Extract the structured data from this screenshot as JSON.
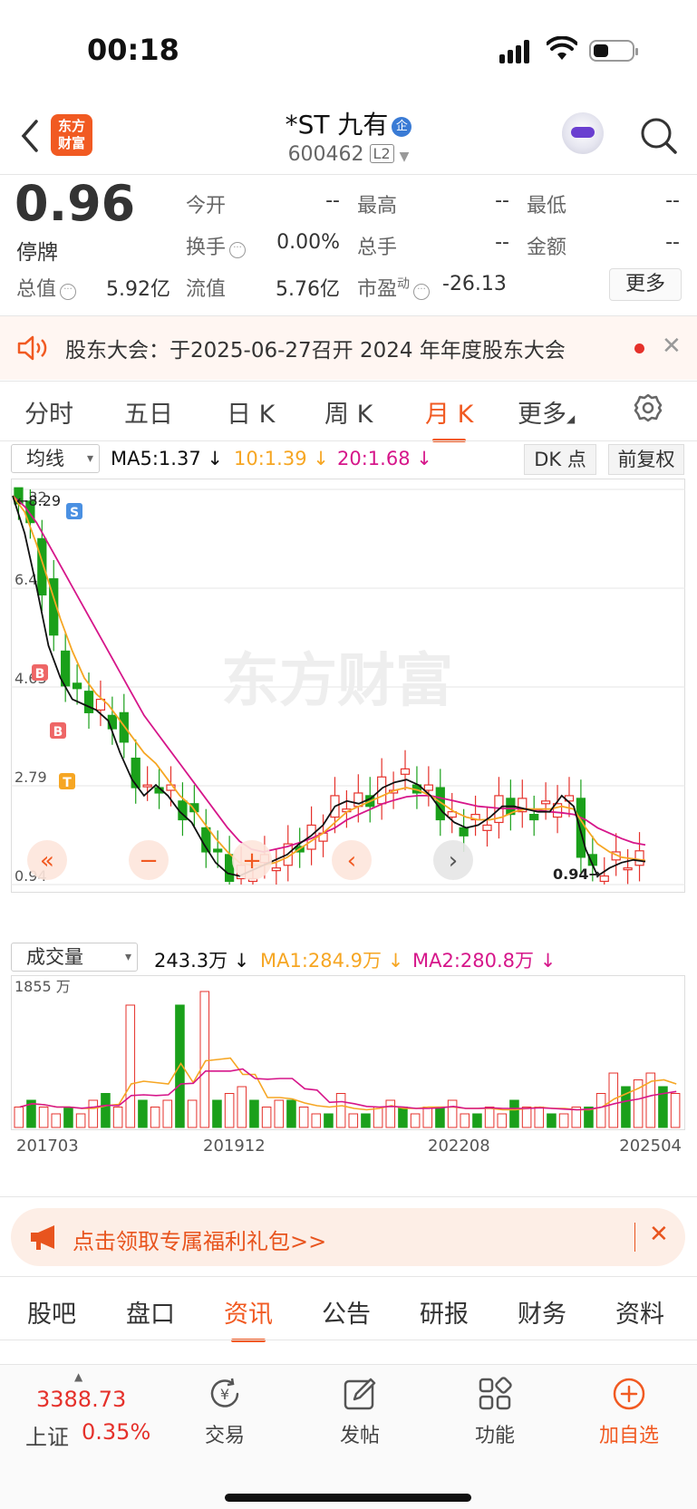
{
  "status": {
    "time": "00:18"
  },
  "header": {
    "logo_text": "东方\n财富",
    "stock_name": "*ST 九有",
    "name_tag": "企",
    "code": "600462",
    "level": "L2"
  },
  "quote": {
    "price": "0.96",
    "status": "停牌",
    "open_label": "今开",
    "open": "--",
    "high_label": "最高",
    "high": "--",
    "low_label": "最低",
    "low": "--",
    "turnover_label": "换手",
    "turnover": "0.00%",
    "volume_label": "总手",
    "volume": "--",
    "amount_label": "金额",
    "amount": "--",
    "mktcap_label": "总值",
    "mktcap": "5.92亿",
    "float_label": "流值",
    "float": "5.76亿",
    "pe_label": "市盈",
    "pe_sup": "动",
    "pe": "-26.13",
    "more": "更多"
  },
  "notice": {
    "text": "股东大会：于2025-06-27召开 2024 年年度股东大会"
  },
  "period_tabs": [
    "分时",
    "五日",
    "日 K",
    "周 K",
    "月 K",
    "更多"
  ],
  "active_period": 4,
  "indicator": {
    "selector": "均线",
    "ma5": "MA5:1.37",
    "ma10": "10:1.39",
    "ma20": "20:1.68",
    "dk": "DK 点",
    "fq": "前复权"
  },
  "volume_bar": {
    "selector": "成交量",
    "value": "243.3万",
    "ma1": "MA1:284.9万",
    "ma2": "MA2:280.8万",
    "max_label": "1855 万"
  },
  "colors": {
    "up": "#e5312b",
    "down": "#1aa01a",
    "ma5": "#111111",
    "ma10": "#f6a623",
    "ma20": "#d6168a",
    "accent": "#f15a22"
  },
  "chart_data": {
    "type": "candlestick",
    "y_ticks": [
      "8.32",
      "6.48",
      "4.63",
      "2.79",
      "0.94"
    ],
    "ylim": [
      0.94,
      8.32
    ],
    "x_ticks": [
      "201703",
      "201912",
      "202208",
      "202504"
    ],
    "high_marker": "←8.29",
    "low_marker": "0.94→",
    "markers": [
      "S",
      "B",
      "B",
      "T"
    ],
    "watermark": "东方财富",
    "ma5": [
      8.2,
      7.5,
      6.5,
      5.4,
      4.8,
      4.4,
      4.3,
      4.2,
      4.0,
      3.4,
      2.9,
      2.6,
      2.8,
      2.6,
      2.3,
      2.1,
      1.7,
      1.35,
      1.15,
      1.1,
      1.2,
      1.3,
      1.4,
      1.5,
      1.7,
      1.85,
      2.05,
      2.4,
      2.5,
      2.45,
      2.55,
      2.75,
      2.85,
      2.9,
      2.8,
      2.6,
      2.3,
      2.1,
      2.0,
      2.05,
      2.2,
      2.4,
      2.4,
      2.35,
      2.3,
      2.3,
      2.6,
      2.4,
      1.6,
      1.1,
      1.25,
      1.35,
      1.4,
      1.37
    ],
    "ma10": [
      8.2,
      7.9,
      7.3,
      6.6,
      5.9,
      5.3,
      4.8,
      4.5,
      4.3,
      4.0,
      3.7,
      3.4,
      3.2,
      2.9,
      2.6,
      2.4,
      2.1,
      1.8,
      1.55,
      1.35,
      1.3,
      1.3,
      1.35,
      1.45,
      1.6,
      1.75,
      1.9,
      2.1,
      2.3,
      2.4,
      2.5,
      2.6,
      2.7,
      2.75,
      2.7,
      2.6,
      2.45,
      2.3,
      2.2,
      2.15,
      2.15,
      2.2,
      2.3,
      2.35,
      2.35,
      2.35,
      2.4,
      2.35,
      2.0,
      1.7,
      1.55,
      1.45,
      1.42,
      1.39
    ],
    "ma20": [
      8.2,
      8.0,
      7.7,
      7.3,
      6.9,
      6.5,
      6.1,
      5.7,
      5.3,
      4.9,
      4.5,
      4.1,
      3.8,
      3.5,
      3.2,
      2.9,
      2.6,
      2.3,
      2.0,
      1.75,
      1.6,
      1.55,
      1.6,
      1.65,
      1.72,
      1.8,
      1.9,
      2.0,
      2.15,
      2.25,
      2.35,
      2.45,
      2.52,
      2.58,
      2.6,
      2.6,
      2.55,
      2.5,
      2.45,
      2.4,
      2.38,
      2.36,
      2.36,
      2.35,
      2.33,
      2.3,
      2.28,
      2.25,
      2.15,
      2.0,
      1.9,
      1.8,
      1.72,
      1.68
    ],
    "volume": [
      3,
      4,
      3,
      2,
      3,
      2,
      4,
      5,
      3,
      18,
      4,
      3,
      4,
      18,
      4,
      20,
      4,
      5,
      6,
      4,
      3,
      4,
      4,
      3,
      2,
      2,
      5,
      2,
      2,
      3,
      4,
      3,
      2,
      3,
      3,
      4,
      2,
      2,
      3,
      2,
      4,
      3,
      3,
      2,
      2,
      3,
      3,
      5,
      8,
      6,
      7,
      8,
      6,
      5
    ]
  },
  "promo": {
    "text": "点击领取专属福利礼包>>"
  },
  "info_tabs": [
    "股吧",
    "盘口",
    "资讯",
    "公告",
    "研报",
    "财务",
    "资料"
  ],
  "active_info": 2,
  "bottom": {
    "index_value": "3388.73",
    "index_name": "上证",
    "index_change": "0.35%",
    "items": [
      "交易",
      "发帖",
      "功能",
      "加自选"
    ]
  }
}
